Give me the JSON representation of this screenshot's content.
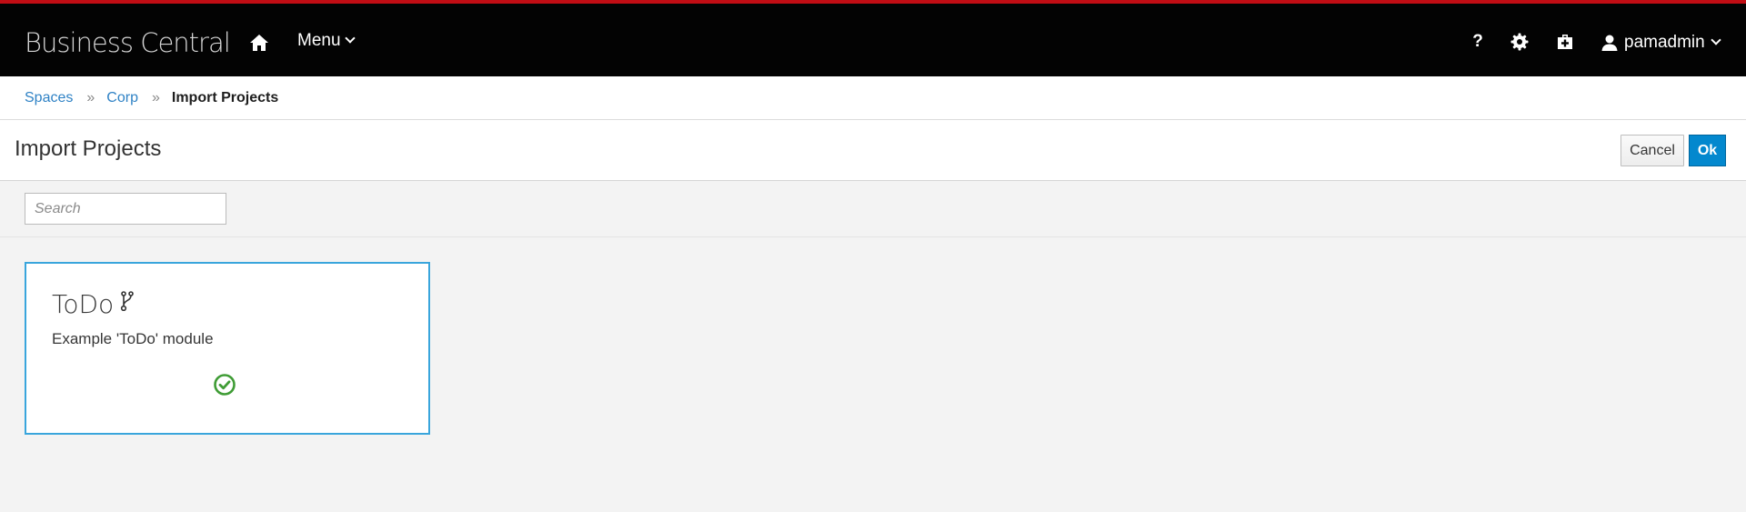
{
  "app": {
    "brand": "Business Central",
    "accent_color": "#c10d14"
  },
  "nav": {
    "home_icon": "home-icon",
    "menu_label": "Menu",
    "help_label": "?",
    "settings_icon": "gear-icon",
    "tasks_icon": "medkit-icon",
    "user_name": "pamadmin"
  },
  "breadcrumb": {
    "items": [
      "Spaces",
      "Corp"
    ],
    "current": "Import Projects",
    "separator": "»"
  },
  "page": {
    "title": "Import Projects",
    "cancel_label": "Cancel",
    "ok_label": "Ok"
  },
  "search": {
    "placeholder": "Search",
    "value": ""
  },
  "projects": [
    {
      "name": "ToDo",
      "description": "Example 'ToDo' module",
      "branch_icon": "branch-icon",
      "status_icon": "check-circle-icon",
      "selected": true,
      "status_color": "#3f9c35",
      "border_color": "#39a5dc"
    }
  ]
}
